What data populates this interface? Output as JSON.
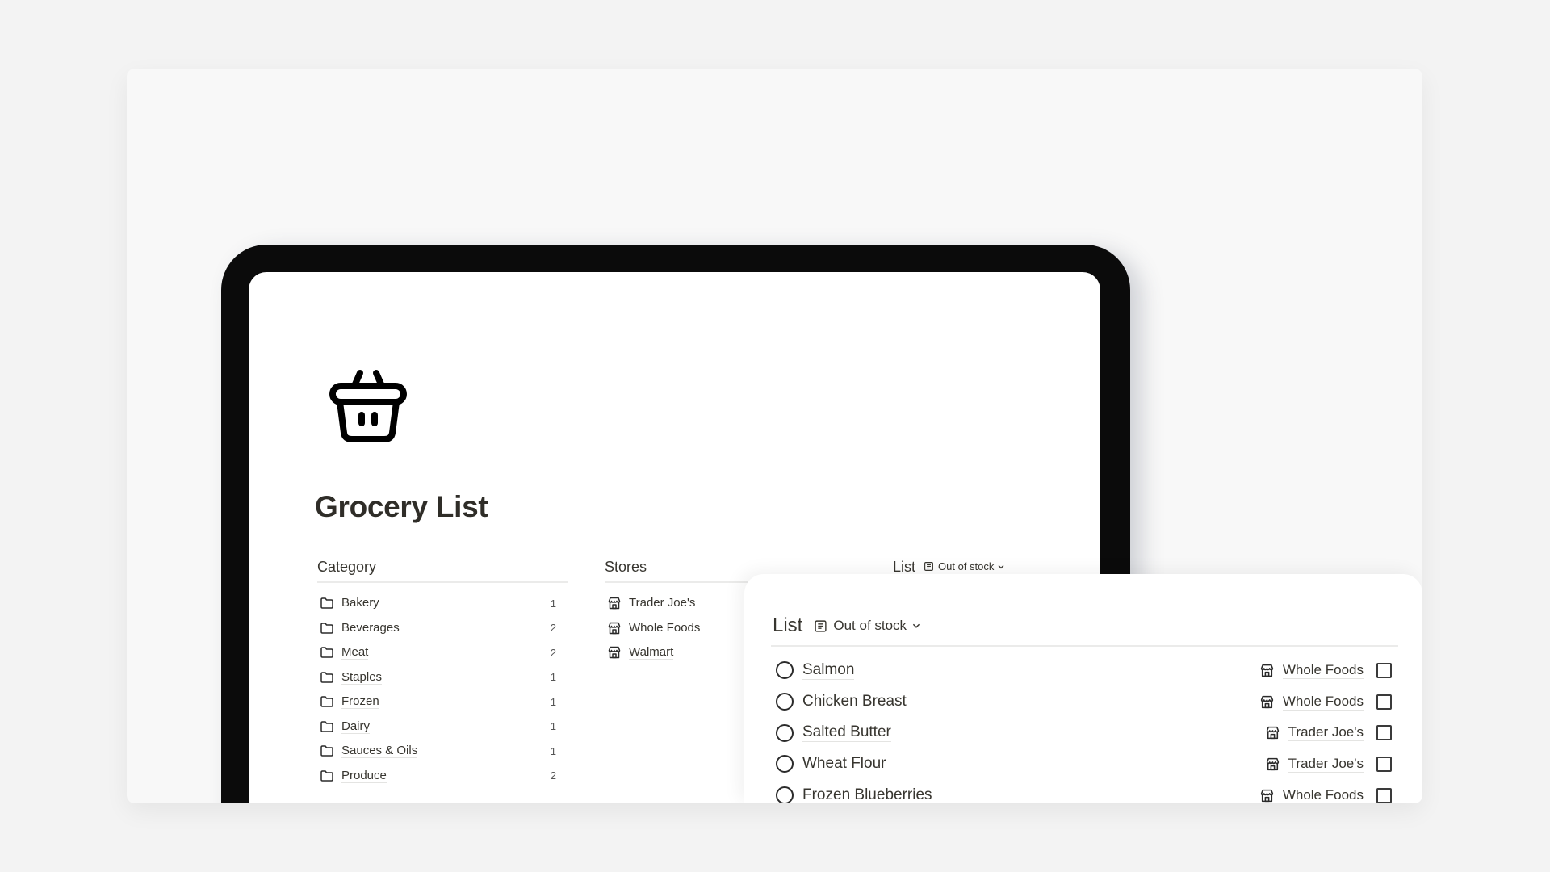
{
  "page": {
    "title": "Grocery List",
    "icon": "shopping-basket-icon"
  },
  "category": {
    "header": "Category",
    "items": [
      {
        "label": "Bakery",
        "count": "1"
      },
      {
        "label": "Beverages",
        "count": "2"
      },
      {
        "label": "Meat",
        "count": "2"
      },
      {
        "label": "Staples",
        "count": "1"
      },
      {
        "label": "Frozen",
        "count": "1"
      },
      {
        "label": "Dairy",
        "count": "1"
      },
      {
        "label": "Sauces & Oils",
        "count": "1"
      },
      {
        "label": "Produce",
        "count": "2"
      }
    ]
  },
  "stores": {
    "header": "Stores",
    "items": [
      {
        "label": "Trader Joe's"
      },
      {
        "label": "Whole Foods"
      },
      {
        "label": "Walmart"
      }
    ]
  },
  "list": {
    "title": "List",
    "view_label": "Out of stock",
    "items": [
      {
        "name": "Salmon",
        "store": "Whole Foods",
        "checked": false
      },
      {
        "name": "Chicken Breast",
        "store": "Whole Foods",
        "checked": false
      },
      {
        "name": "Salted Butter",
        "store": "Trader Joe's",
        "checked": false
      },
      {
        "name": "Wheat Flour",
        "store": "Trader Joe's",
        "checked": false
      },
      {
        "name": "Frozen Blueberries",
        "store": "Whole Foods",
        "checked": false
      }
    ]
  }
}
